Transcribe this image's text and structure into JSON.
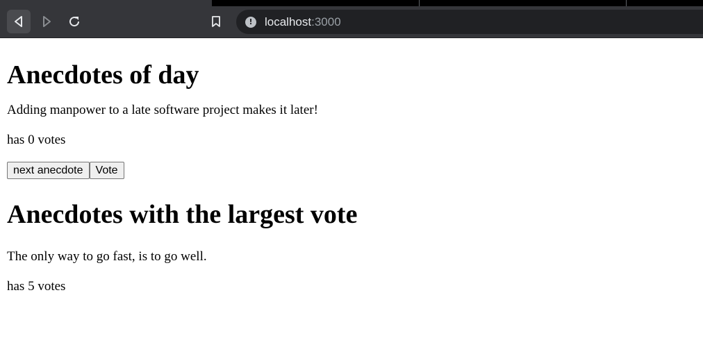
{
  "browser": {
    "url_host": "localhost",
    "url_port": ":3000",
    "icons": {
      "back": "back-arrow-icon",
      "forward": "forward-arrow-icon",
      "reload": "reload-icon",
      "bookmark": "bookmark-icon",
      "site_info": "info-icon"
    }
  },
  "page": {
    "day_heading": "Anecdotes of day",
    "anecdote": "Adding manpower to a late software project makes it later!",
    "votes": "has 0 votes",
    "buttons": {
      "next_label": "next anecdote",
      "vote_label": "Vote"
    },
    "largest_heading": "Anecdotes with the largest vote",
    "top_anecdote": "The only way to go fast, is to go well.",
    "top_votes": "has 5 votes"
  },
  "colors": {
    "chrome_bg": "#35363a",
    "omnibox_bg": "#202124",
    "tabstrip_bg": "#000000"
  }
}
